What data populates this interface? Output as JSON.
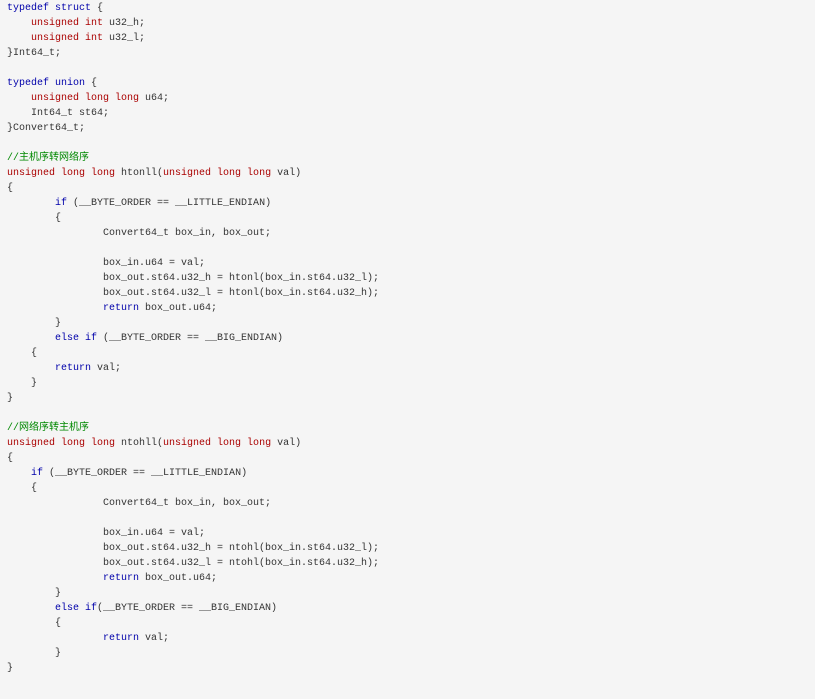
{
  "colors": {
    "background": "#f5f5f5",
    "plain": "#333333",
    "keyword": "#0000aa",
    "type": "#aa0000",
    "comment": "#008800"
  },
  "code_lines": [
    [
      {
        "t": "typedef struct",
        "c": "keyword"
      },
      {
        "t": " {",
        "c": "plain"
      }
    ],
    [
      {
        "t": "    ",
        "c": "plain"
      },
      {
        "t": "unsigned int",
        "c": "type"
      },
      {
        "t": " u32_h;",
        "c": "plain"
      }
    ],
    [
      {
        "t": "    ",
        "c": "plain"
      },
      {
        "t": "unsigned int",
        "c": "type"
      },
      {
        "t": " u32_l;",
        "c": "plain"
      }
    ],
    [
      {
        "t": "}Int64_t;",
        "c": "plain"
      }
    ],
    [],
    [
      {
        "t": "typedef union",
        "c": "keyword"
      },
      {
        "t": " {",
        "c": "plain"
      }
    ],
    [
      {
        "t": "    ",
        "c": "plain"
      },
      {
        "t": "unsigned long long",
        "c": "type"
      },
      {
        "t": " u64;",
        "c": "plain"
      }
    ],
    [
      {
        "t": "    Int64_t st64;",
        "c": "plain"
      }
    ],
    [
      {
        "t": "}Convert64_t;",
        "c": "plain"
      }
    ],
    [],
    [
      {
        "t": "//主机序转网络序",
        "c": "comment"
      }
    ],
    [
      {
        "t": "unsigned long long",
        "c": "type"
      },
      {
        "t": " htonll(",
        "c": "plain"
      },
      {
        "t": "unsigned long long",
        "c": "type"
      },
      {
        "t": " val)",
        "c": "plain"
      }
    ],
    [
      {
        "t": "{",
        "c": "plain"
      }
    ],
    [
      {
        "t": "        ",
        "c": "plain"
      },
      {
        "t": "if",
        "c": "keyword"
      },
      {
        "t": " (__BYTE_ORDER == __LITTLE_ENDIAN)",
        "c": "plain"
      }
    ],
    [
      {
        "t": "        {",
        "c": "plain"
      }
    ],
    [
      {
        "t": "                Convert64_t box_in, box_out;",
        "c": "plain"
      }
    ],
    [],
    [
      {
        "t": "                box_in.u64 = val;",
        "c": "plain"
      }
    ],
    [
      {
        "t": "                box_out.st64.u32_h = htonl(box_in.st64.u32_l);",
        "c": "plain"
      }
    ],
    [
      {
        "t": "                box_out.st64.u32_l = htonl(box_in.st64.u32_h);",
        "c": "plain"
      }
    ],
    [
      {
        "t": "                ",
        "c": "plain"
      },
      {
        "t": "return",
        "c": "keyword"
      },
      {
        "t": " box_out.u64;",
        "c": "plain"
      }
    ],
    [
      {
        "t": "        }",
        "c": "plain"
      }
    ],
    [
      {
        "t": "        ",
        "c": "plain"
      },
      {
        "t": "else if",
        "c": "keyword"
      },
      {
        "t": " (__BYTE_ORDER == __BIG_ENDIAN)",
        "c": "plain"
      }
    ],
    [
      {
        "t": "    {",
        "c": "plain"
      }
    ],
    [
      {
        "t": "        ",
        "c": "plain"
      },
      {
        "t": "return",
        "c": "keyword"
      },
      {
        "t": " val;",
        "c": "plain"
      }
    ],
    [
      {
        "t": "    }",
        "c": "plain"
      }
    ],
    [
      {
        "t": "}",
        "c": "plain"
      }
    ],
    [],
    [
      {
        "t": "//网络序转主机序",
        "c": "comment"
      }
    ],
    [
      {
        "t": "unsigned long long",
        "c": "type"
      },
      {
        "t": " ntohll(",
        "c": "plain"
      },
      {
        "t": "unsigned long long",
        "c": "type"
      },
      {
        "t": " val)",
        "c": "plain"
      }
    ],
    [
      {
        "t": "{",
        "c": "plain"
      }
    ],
    [
      {
        "t": "    ",
        "c": "plain"
      },
      {
        "t": "if",
        "c": "keyword"
      },
      {
        "t": " (__BYTE_ORDER == __LITTLE_ENDIAN)",
        "c": "plain"
      }
    ],
    [
      {
        "t": "    {",
        "c": "plain"
      }
    ],
    [
      {
        "t": "                Convert64_t box_in, box_out;",
        "c": "plain"
      }
    ],
    [],
    [
      {
        "t": "                box_in.u64 = val;",
        "c": "plain"
      }
    ],
    [
      {
        "t": "                box_out.st64.u32_h = ntohl(box_in.st64.u32_l);",
        "c": "plain"
      }
    ],
    [
      {
        "t": "                box_out.st64.u32_l = ntohl(box_in.st64.u32_h);",
        "c": "plain"
      }
    ],
    [
      {
        "t": "                ",
        "c": "plain"
      },
      {
        "t": "return",
        "c": "keyword"
      },
      {
        "t": " box_out.u64;",
        "c": "plain"
      }
    ],
    [
      {
        "t": "        }",
        "c": "plain"
      }
    ],
    [
      {
        "t": "        ",
        "c": "plain"
      },
      {
        "t": "else if",
        "c": "keyword"
      },
      {
        "t": "(__BYTE_ORDER == __BIG_ENDIAN)",
        "c": "plain"
      }
    ],
    [
      {
        "t": "        {",
        "c": "plain"
      }
    ],
    [
      {
        "t": "                ",
        "c": "plain"
      },
      {
        "t": "return",
        "c": "keyword"
      },
      {
        "t": " val;",
        "c": "plain"
      }
    ],
    [
      {
        "t": "        }",
        "c": "plain"
      }
    ],
    [
      {
        "t": "}",
        "c": "plain"
      }
    ]
  ]
}
